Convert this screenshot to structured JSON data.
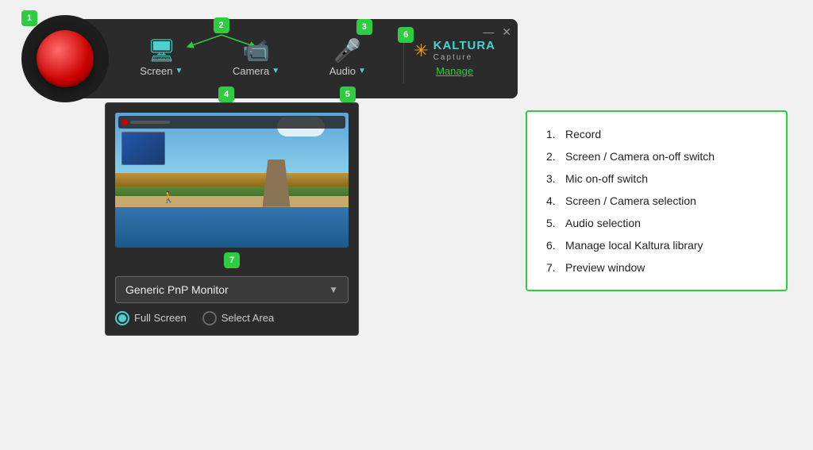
{
  "app": {
    "title": "Kaltura Capture"
  },
  "toolbar": {
    "record_label": "Record",
    "screen_label": "Screen",
    "camera_label": "Camera",
    "audio_label": "Audio",
    "manage_label": "Manage",
    "kaltura_name": "KALTURA",
    "kaltura_sub": "Capture"
  },
  "badges": {
    "b1": "1",
    "b2": "2",
    "b3": "3",
    "b4": "4",
    "b5": "5",
    "b6": "6",
    "b7": "7"
  },
  "preview": {
    "monitor_label": "Generic PnP Monitor",
    "full_screen_label": "Full Screen",
    "select_area_label": "Select Area"
  },
  "info_list": [
    {
      "num": "1.",
      "text": "Record"
    },
    {
      "num": "2.",
      "text": "Screen / Camera on-off switch"
    },
    {
      "num": "3.",
      "text": "Mic on-off switch"
    },
    {
      "num": "4.",
      "text": "Screen / Camera selection"
    },
    {
      "num": "5.",
      "text": "Audio selection"
    },
    {
      "num": "6.",
      "text": "Manage local Kaltura library"
    },
    {
      "num": "7.",
      "text": "Preview window"
    }
  ]
}
